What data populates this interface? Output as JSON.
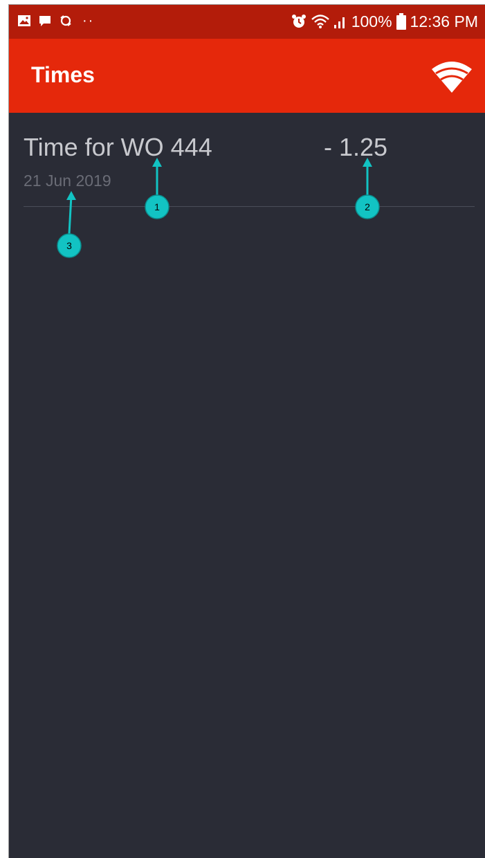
{
  "status_bar": {
    "battery": "100%",
    "time": "12:36 PM",
    "dots": "··",
    "icons": [
      "image-icon",
      "message-icon",
      "sync-icon",
      "alarm-icon",
      "wifi-icon",
      "signal-icon",
      "battery-icon"
    ]
  },
  "app_bar": {
    "title": "Times",
    "action_icon": "wifi-icon"
  },
  "list": {
    "items": [
      {
        "title": "Time for WO 444",
        "value": "-  1.25",
        "date": "21 Jun 2019"
      }
    ]
  },
  "annotations": [
    "1",
    "2",
    "3"
  ],
  "colors": {
    "status_bar": "#b31c0a",
    "app_bar": "#e5280b",
    "background": "#2a2c36",
    "callout": "#12c3c3"
  }
}
